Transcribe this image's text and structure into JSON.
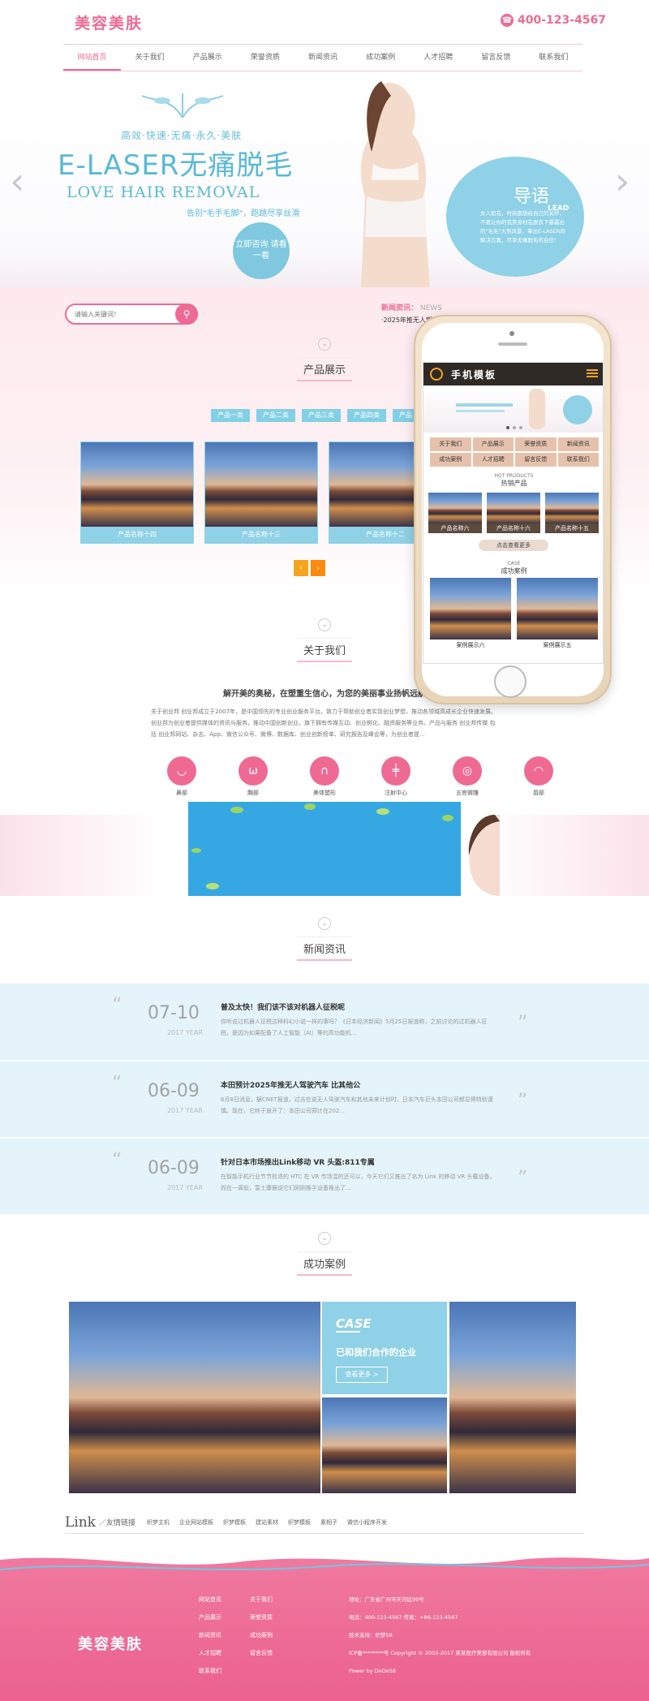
{
  "header": {
    "logo": "美容美肤",
    "phone": "400-123-4567",
    "nav": [
      "网站首页",
      "关于我们",
      "产品展示",
      "荣誉资质",
      "新闻资讯",
      "成功案例",
      "人才招聘",
      "留言反馈",
      "联系我们"
    ]
  },
  "banner": {
    "subtitle": "高效·快速·无痛·永久·美肤",
    "title": "E-LASER无痛脱毛",
    "english": "LOVE HAIR REMOVAL",
    "tagline": "告别\"毛手毛脚\"，跑跳尽享丝滑",
    "button": "立即咨询 请看一看",
    "lead_title": "导语",
    "lead_en": "LEAD",
    "lead_body": "女人如花，时刻都想给自己的关怀，不要让你的完美身材在脱衣下暴露出的\"毛毛\"大煞风景，拿出E-LASER的解决方案，尽享无痛脱毛的自信！"
  },
  "search": {
    "placeholder": "请输入关键词！"
  },
  "news_ticker": {
    "label": "新闻资讯：",
    "en": "NEWS",
    "item": "·2025年推无人驾驶汽车 比其他"
  },
  "products": {
    "title": "产品展示",
    "tabs": [
      "产品一类",
      "产品二类",
      "产品三类",
      "产品四类",
      "产品"
    ],
    "items": [
      "产品名称十四",
      "产品名称十三",
      "产品名称十二"
    ],
    "pager_prev": "‹",
    "pager_next": "›"
  },
  "about": {
    "title": "关于我们",
    "heading": "解开美的奥秘，在塑重生信心，为您的美丽事业扬帆远航",
    "body": "关于创业邦 创业邦成立于2007年，是中国领先的专业创业服务平台。致力于帮助创业者实现创业梦想，推动各领域高成长企业快速发展。创业邦为创业者提供媒体的资讯与服务，推动中国创新创业。旗下拥有传媒互动、创业孵化、融资服务等业务。产品与服务 创业邦传媒 包括 创业邦网站、杂志、App、微信公众号、微博、数据库、创业创新榜单、研究报告及峰会等，为创业者提...",
    "icons": [
      "鼻部",
      "胸部",
      "美体塑形",
      "注射中心",
      "五官微雕",
      "唇部"
    ]
  },
  "news": {
    "title": "新闻资讯",
    "items": [
      {
        "date": "07-10",
        "year": "2017 YEAR",
        "title": "普及太快！我们该不该对机器人征税呢",
        "summary": "你听说过机器人征税这种科幻小说一样的事吗？《日本经济新闻》5月25日报道称，之前讨论的过机器人征税，是因为如果配备了人工智能（AI）等的高功能机..."
      },
      {
        "date": "06-09",
        "year": "2017 YEAR",
        "title": "本田预计2025年推无人驾驶汽车 比其他公",
        "summary": "6月8日消息，据CNET报道，过去在说无人驾驶汽车和其他未来计划时，日本汽车巨头本田公司都显得特别谨慎。现在，它终于放开了：本田公司预计在202..."
      },
      {
        "date": "06-09",
        "year": "2017 YEAR",
        "title": "针对日本市场推出Link移动 VR 头盔:811专属",
        "summary": "在智能手机行业节节败退的 HTC 在 VR 市场混的还可以，今天它们又推出了名为 Link 的移动 VR 头戴设备，而在一周前，富士康据说它们刚刚推手设备推出了..."
      }
    ]
  },
  "cases": {
    "title": "成功案例",
    "box_title": "CASE",
    "box_desc": "已和我们合作的企业",
    "box_btn": "查看更多 >"
  },
  "links": {
    "label": "Link",
    "sub": "／友情链接",
    "items": [
      "织梦主机",
      "企业网站模板",
      "织梦模板",
      "建站素材",
      "织梦模板",
      "素相子",
      "微信小程序开发"
    ]
  },
  "footer": {
    "logo": "美容美肤",
    "col1": [
      "网站首页",
      "产品展示",
      "新闻资讯",
      "人才招聘",
      "联系我们"
    ],
    "col2": [
      "关于我们",
      "荣誉资质",
      "成功案例",
      "留言反馈"
    ],
    "info": [
      "地址：广东省广州市天河区99号",
      "电话：400-123-4567   传真：+86-123-4567",
      "技术支持：织梦58",
      "ICP备********号    Copyright © 2002-2017 某某医疗美容有限公司 版权所有",
      "Power by DeDe58"
    ]
  },
  "mobile": {
    "title": "手机模板",
    "menu": [
      "关于我们",
      "产品展示",
      "荣誉资质",
      "新闻资讯",
      "成功案例",
      "人才招聘",
      "留言反馈",
      "联系我们"
    ],
    "hot_en": "HOT PRODUCTS",
    "hot_cn": "热销产品",
    "products": [
      "产品名称六",
      "产品名称十六",
      "产品名称十五"
    ],
    "more": "点击查看更多",
    "case_en": "CASE",
    "case_cn": "成功案例",
    "cases": [
      "案例展示六",
      "案例展示五"
    ]
  },
  "colors": {
    "pink": "#ef6a93",
    "blue": "#8fd1e6",
    "orange": "#f6a41d"
  }
}
